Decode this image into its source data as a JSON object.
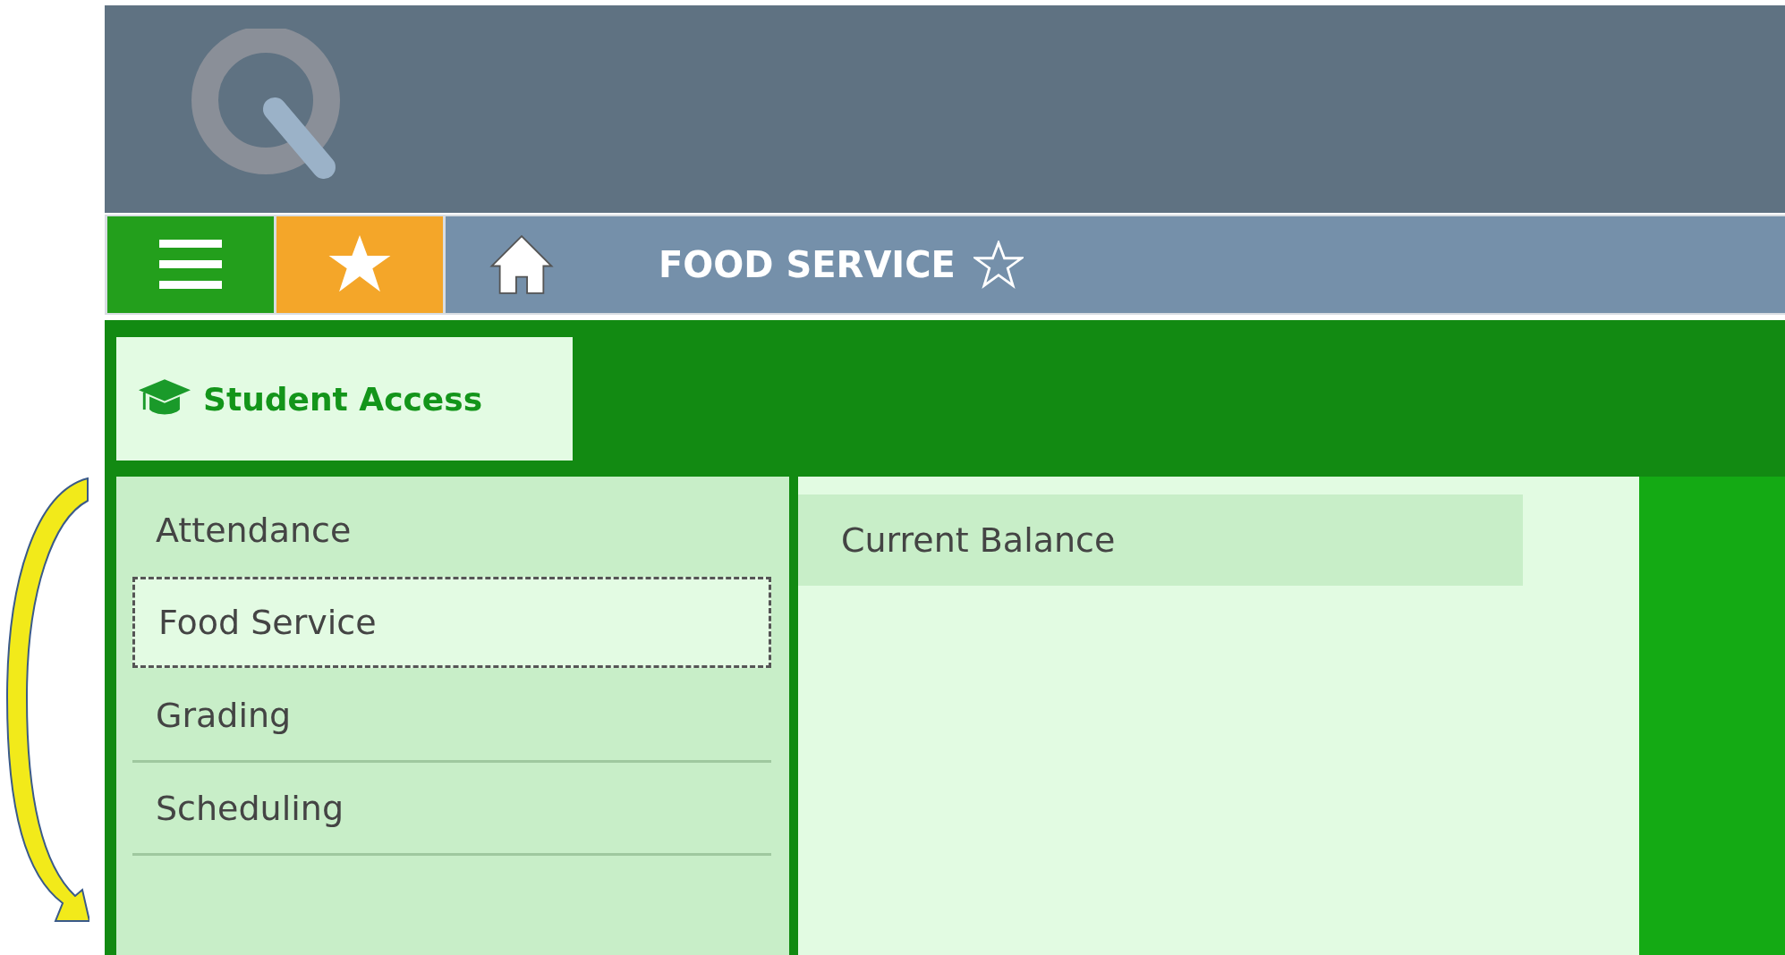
{
  "nav_bar": {
    "title": "FOOD SERVICE",
    "favorite": false
  },
  "module_tab": {
    "label": "Student Access"
  },
  "sidebar": {
    "items": [
      {
        "label": "Attendance",
        "selected": false
      },
      {
        "label": "Food Service",
        "selected": true
      },
      {
        "label": "Grading",
        "selected": false
      },
      {
        "label": "Scheduling",
        "selected": false
      }
    ]
  },
  "content": {
    "items": [
      {
        "label": "Current Balance"
      }
    ]
  }
}
